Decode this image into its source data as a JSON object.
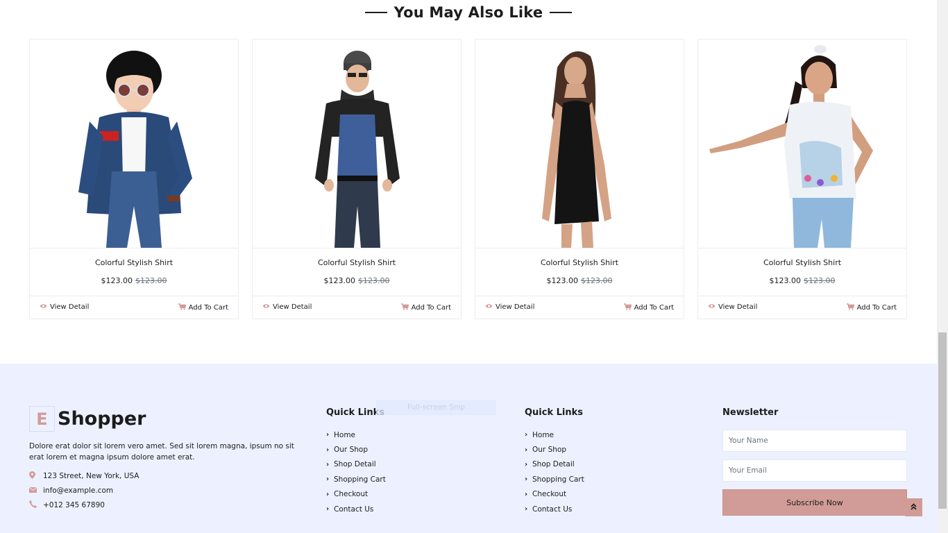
{
  "section": {
    "title": "You May Also Like"
  },
  "products": [
    {
      "name": "Colorful Stylish Shirt",
      "price": "$123.00",
      "old_price": "$123.00",
      "view_label": "View Detail",
      "cart_label": "Add To Cart",
      "image": "boy-denim-jacket"
    },
    {
      "name": "Colorful Stylish Shirt",
      "price": "$123.00",
      "old_price": "$123.00",
      "view_label": "View Detail",
      "cart_label": "Add To Cart",
      "image": "man-leather-jacket"
    },
    {
      "name": "Colorful Stylish Shirt",
      "price": "$123.00",
      "old_price": "$123.00",
      "view_label": "View Detail",
      "cart_label": "Add To Cart",
      "image": "woman-black-dress"
    },
    {
      "name": "Colorful Stylish Shirt",
      "price": "$123.00",
      "old_price": "$123.00",
      "view_label": "View Detail",
      "cart_label": "Add To Cart",
      "image": "girl-white-top"
    }
  ],
  "footer": {
    "brand": {
      "letter": "E",
      "name": "Shopper"
    },
    "about": "Dolore erat dolor sit lorem vero amet. Sed sit lorem magna, ipsum no sit erat lorem et magna ipsum dolore amet erat.",
    "contact": {
      "address": "123 Street, New York, USA",
      "email": "info@example.com",
      "phone": "+012 345 67890"
    },
    "quick_links_1": {
      "title": "Quick Links",
      "items": [
        "Home",
        "Our Shop",
        "Shop Detail",
        "Shopping Cart",
        "Checkout",
        "Contact Us"
      ]
    },
    "quick_links_2": {
      "title": "Quick Links",
      "items": [
        "Home",
        "Our Shop",
        "Shop Detail",
        "Shopping Cart",
        "Checkout",
        "Contact Us"
      ]
    },
    "newsletter": {
      "title": "Newsletter",
      "name_placeholder": "Your Name",
      "email_placeholder": "Your Email",
      "button_label": "Subscribe Now"
    },
    "snip_overlay": "Full-screen Snip",
    "back_to_top_icon": "double-chevron-up-icon"
  },
  "colors": {
    "accent": "#d19c97",
    "footer_bg": "#edf1ff",
    "text": "#1c1c1c"
  }
}
